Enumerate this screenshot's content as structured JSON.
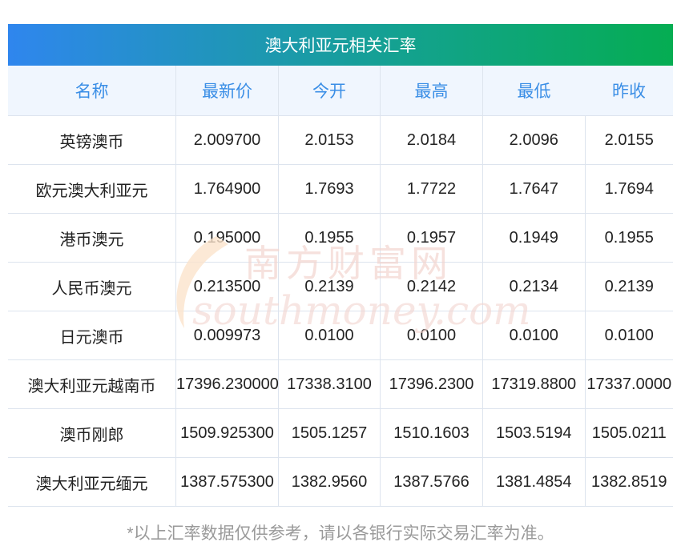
{
  "title": "澳大利亚元相关汇率",
  "columns": [
    "名称",
    "最新价",
    "今开",
    "最高",
    "最低",
    "昨收"
  ],
  "rows": [
    [
      "英镑澳币",
      "2.009700",
      "2.0153",
      "2.0184",
      "2.0096",
      "2.0155"
    ],
    [
      "欧元澳大利亚元",
      "1.764900",
      "1.7693",
      "1.7722",
      "1.7647",
      "1.7694"
    ],
    [
      "港币澳元",
      "0.195000",
      "0.1955",
      "0.1957",
      "0.1949",
      "0.1955"
    ],
    [
      "人民币澳元",
      "0.213500",
      "0.2139",
      "0.2142",
      "0.2134",
      "0.2139"
    ],
    [
      "日元澳币",
      "0.009973",
      "0.0100",
      "0.0100",
      "0.0100",
      "0.0100"
    ],
    [
      "澳大利亚元越南币",
      "17396.230000",
      "17338.3100",
      "17396.2300",
      "17319.8800",
      "17337.0000"
    ],
    [
      "澳币刚郎",
      "1509.925300",
      "1505.1257",
      "1510.1603",
      "1503.5194",
      "1505.0211"
    ],
    [
      "澳大利亚元缅元",
      "1387.575300",
      "1382.9560",
      "1387.5766",
      "1381.4854",
      "1382.8519"
    ]
  ],
  "footer": "*以上汇率数据仅供参考，请以各银行实际交易汇率为准。",
  "watermark": {
    "cn": "南方财富网",
    "en": "southmoney.com"
  }
}
